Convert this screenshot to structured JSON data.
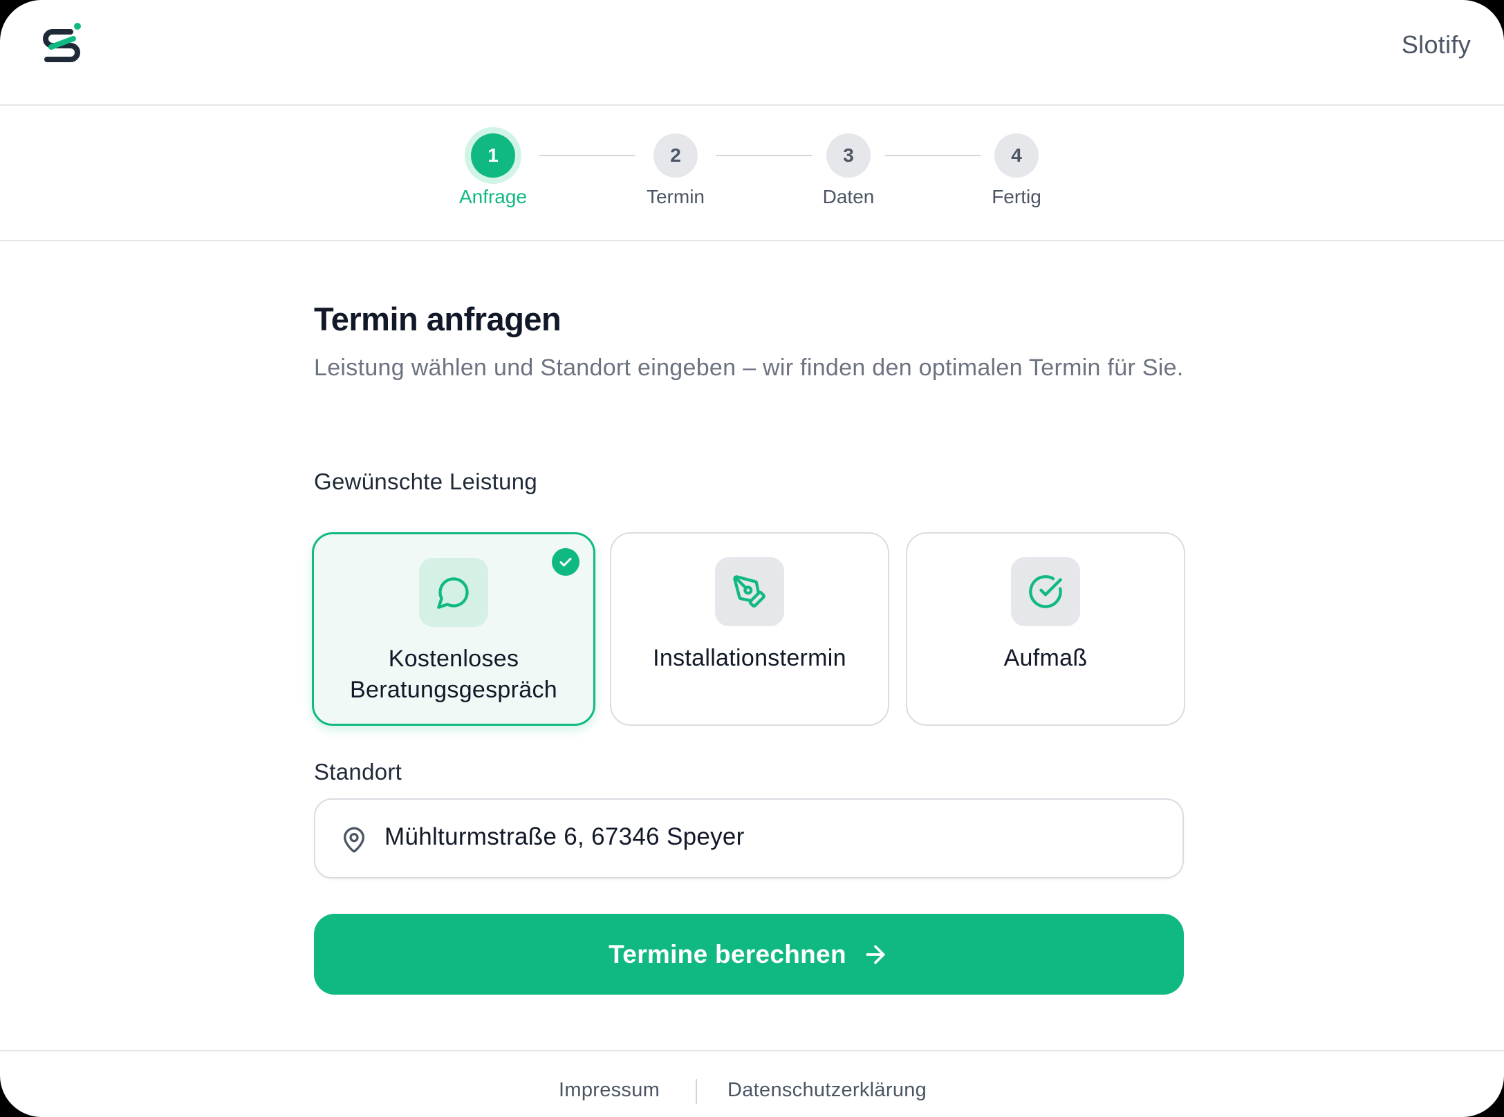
{
  "app": {
    "brand": "Slotify",
    "logo_icon": "slotify-logo-icon"
  },
  "colors": {
    "accent": "#10b981",
    "accent_light": "#d1f4e6",
    "text_primary": "#111827",
    "text_secondary": "#6b7280"
  },
  "stepper": {
    "steps": [
      {
        "number": "1",
        "label": "Anfrage",
        "state": "active"
      },
      {
        "number": "2",
        "label": "Termin",
        "state": "upcoming"
      },
      {
        "number": "3",
        "label": "Daten",
        "state": "upcoming"
      },
      {
        "number": "4",
        "label": "Fertig",
        "state": "upcoming"
      }
    ]
  },
  "main": {
    "title": "Termin anfragen",
    "subtitle": "Leistung wählen und Standort eingeben – wir finden den optimalen Termin für Sie.",
    "service_label": "Gewünschte Leistung",
    "services": [
      {
        "label": "Kostenloses Beratungsgespräch",
        "icon": "chat-bubble-icon",
        "selected": true
      },
      {
        "label": "Installationstermin",
        "icon": "pen-tool-icon",
        "selected": false
      },
      {
        "label": "Aufmaß",
        "icon": "check-circle-icon",
        "selected": false
      }
    ],
    "location_label": "Standort",
    "location_value": "Mühlturmstraße 6, 67346 Speyer",
    "location_icon": "map-pin-icon",
    "submit_label": "Termine berechnen",
    "submit_icon": "arrow-right-icon"
  },
  "footer": {
    "links": [
      "Impressum",
      "Datenschutzerklärung"
    ]
  }
}
